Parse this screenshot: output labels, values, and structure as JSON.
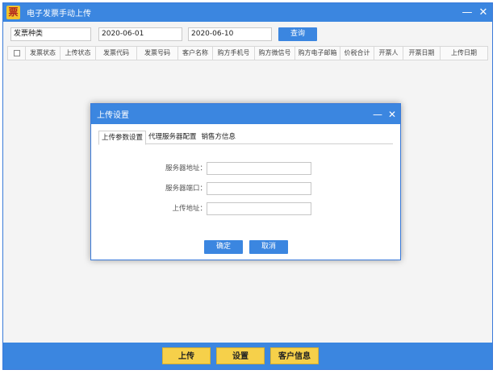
{
  "window": {
    "icon_glyph": "票",
    "title": "电子发票手动上传",
    "minimize": "—",
    "close": "✕"
  },
  "filters": {
    "invoice_type": "发票种类",
    "date_start": "2020-06-01",
    "date_end": "2020-06-10",
    "query_label": "查询"
  },
  "table": {
    "columns": [
      "发票状态",
      "上传状态",
      "发票代码",
      "发票号码",
      "客户名称",
      "购方手机号",
      "购方微信号",
      "购方电子邮箱",
      "价税合计",
      "开票人",
      "开票日期",
      "上传日期"
    ]
  },
  "bottom": {
    "upload_label": "上传",
    "settings_label": "设置",
    "customer_label": "客户信息"
  },
  "dialog": {
    "title": "上传设置",
    "minimize": "—",
    "close": "✕",
    "tabs": [
      "上传参数设置",
      "代理服务器配置",
      "销售方信息"
    ],
    "fields": [
      {
        "label": "服务器地址：",
        "value": ""
      },
      {
        "label": "服务器端口：",
        "value": ""
      },
      {
        "label": "上传地址：",
        "value": ""
      }
    ],
    "ok_label": "确定",
    "cancel_label": "取消"
  },
  "colors": {
    "accent": "#3b86e0",
    "button_yellow": "#f6d04a"
  }
}
